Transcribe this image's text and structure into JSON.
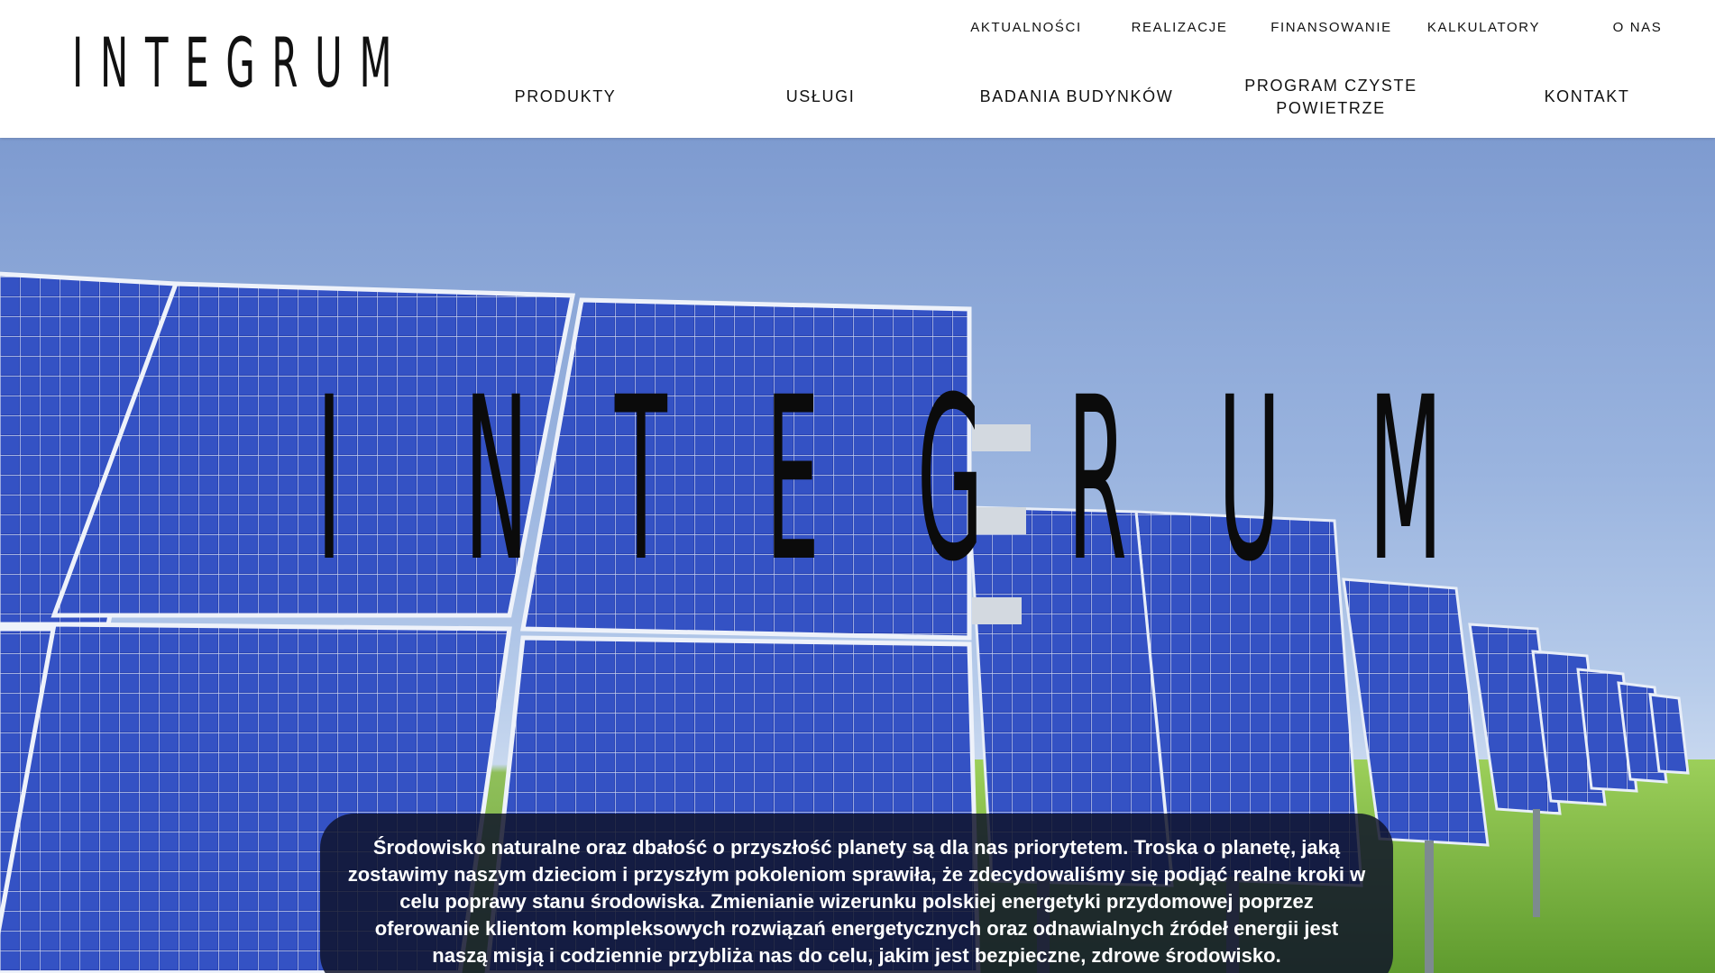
{
  "header": {
    "logo": "INTEGRUM",
    "top_nav": [
      "AKTUALNOŚCI",
      "REALIZACJE",
      "FINANSOWANIE",
      "KALKULATORY",
      "O NAS"
    ],
    "main_nav": [
      "PRODUKTY",
      "USŁUGI",
      "BADANIA BUDYNKÓW",
      "PROGRAM CZYSTE POWIETRZE",
      "KONTAKT"
    ]
  },
  "hero": {
    "title": "INTEGRUM",
    "mission": "Środowisko naturalne oraz dbałość o przyszłość planety są dla nas priorytetem. Troska o planetę, jaką zostawimy naszym dzieciom i przyszłym pokoleniom sprawiła, że zdecydowaliśmy się podjąć realne kroki w celu poprawy stanu środowiska. Zmienianie wizerunku polskiej energetyki przydomowej poprzez oferowanie klientom kompleksowych rozwiązań energetycznych oraz odnawialnych źródeł energii jest naszą misją i codziennie przybliża nas do celu, jakim jest bezpieczne, zdrowe środowisko."
  },
  "colors": {
    "header_bg": "#ffffff",
    "text": "#111111",
    "sky": "#8ca9da",
    "panel": "#2b45b5",
    "grass": "#7cb342",
    "mission_box": "#0e1228"
  }
}
